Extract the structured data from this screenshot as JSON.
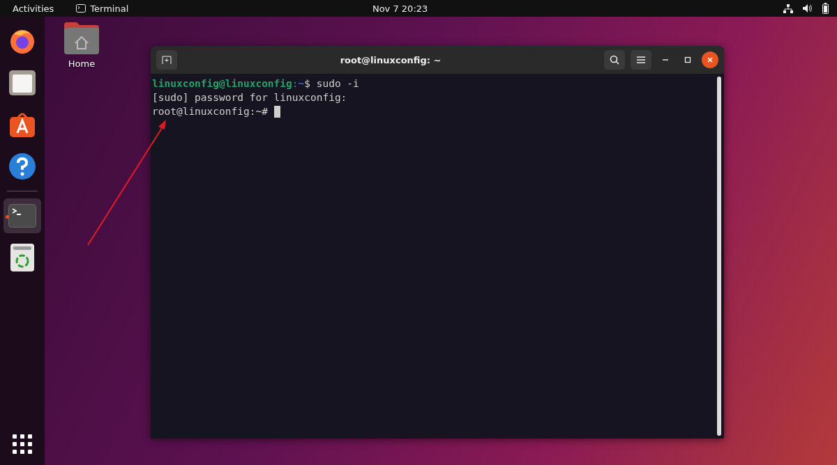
{
  "top_bar": {
    "activities": "Activities",
    "app_name": "Terminal",
    "clock": "Nov 7  20:23"
  },
  "dock": {
    "items": [
      {
        "kind": "browser",
        "running": false,
        "selected": false
      },
      {
        "kind": "files",
        "running": false,
        "selected": false
      },
      {
        "kind": "store",
        "running": false,
        "selected": false
      },
      {
        "kind": "help",
        "running": false,
        "selected": false
      },
      {
        "kind": "terminal",
        "running": true,
        "selected": true
      },
      {
        "kind": "trash",
        "running": false,
        "selected": false
      }
    ]
  },
  "desktop_icons": [
    {
      "label": "Home"
    }
  ],
  "window": {
    "title": "root@linuxconfig: ~",
    "lines": [
      {
        "segments": [
          {
            "kind": "user",
            "text": "linuxconfig@linuxconfig"
          },
          {
            "kind": "path",
            "text": ":~"
          },
          {
            "kind": "plain",
            "text": "$ sudo -i"
          }
        ],
        "cursor": false
      },
      {
        "segments": [
          {
            "kind": "plain",
            "text": "[sudo] password for linuxconfig:"
          }
        ],
        "cursor": false
      },
      {
        "segments": [
          {
            "kind": "plain",
            "text": "root@linuxconfig:~# "
          }
        ],
        "cursor": true
      }
    ]
  }
}
